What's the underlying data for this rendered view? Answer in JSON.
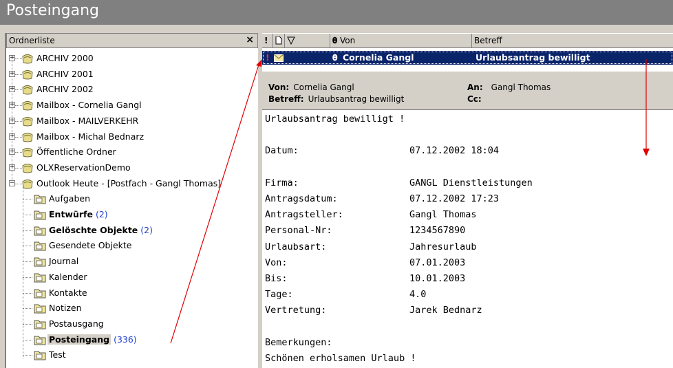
{
  "window": {
    "title": "Posteingang"
  },
  "folder_pane": {
    "header_label": "Ordnerliste",
    "close_glyph": "×",
    "items": [
      {
        "label": "ARCHIV 2000",
        "count": "",
        "level": 0,
        "expander": "+",
        "icon": "pst-folder-icon",
        "bold": false
      },
      {
        "label": "ARCHIV 2001",
        "count": "",
        "level": 0,
        "expander": "+",
        "icon": "pst-folder-icon",
        "bold": false
      },
      {
        "label": "ARCHIV 2002",
        "count": "",
        "level": 0,
        "expander": "+",
        "icon": "pst-folder-icon",
        "bold": false
      },
      {
        "label": "Mailbox - Cornelia Gangl",
        "count": "",
        "level": 0,
        "expander": "+",
        "icon": "mailbox-icon",
        "bold": false
      },
      {
        "label": "Mailbox - MAILVERKEHR",
        "count": "",
        "level": 0,
        "expander": "+",
        "icon": "mailbox-icon",
        "bold": false
      },
      {
        "label": "Mailbox - Michal Bednarz",
        "count": "",
        "level": 0,
        "expander": "+",
        "icon": "mailbox-icon",
        "bold": false
      },
      {
        "label": "Öffentliche Ordner",
        "count": "",
        "level": 0,
        "expander": "+",
        "icon": "public-folders-icon",
        "bold": false
      },
      {
        "label": "OLXReservationDemo",
        "count": "",
        "level": 0,
        "expander": "+",
        "icon": "pst-folder-icon",
        "bold": false
      },
      {
        "label": "Outlook Heute - [Postfach - Gangl Thomas]",
        "count": "",
        "level": 0,
        "expander": "−",
        "icon": "outlook-today-icon",
        "bold": false
      },
      {
        "label": "Aufgaben",
        "count": "",
        "level": 1,
        "expander": "",
        "icon": "tasks-icon",
        "bold": false
      },
      {
        "label": "Entwürfe",
        "count": "(2)",
        "level": 1,
        "expander": "",
        "icon": "drafts-icon",
        "bold": true
      },
      {
        "label": "Gelöschte Objekte",
        "count": "(2)",
        "level": 1,
        "expander": "",
        "icon": "deleted-items-icon",
        "bold": true
      },
      {
        "label": "Gesendete Objekte",
        "count": "",
        "level": 1,
        "expander": "",
        "icon": "sent-items-icon",
        "bold": false
      },
      {
        "label": "Journal",
        "count": "",
        "level": 1,
        "expander": "",
        "icon": "journal-icon",
        "bold": false
      },
      {
        "label": "Kalender",
        "count": "",
        "level": 1,
        "expander": "",
        "icon": "calendar-icon",
        "bold": false
      },
      {
        "label": "Kontakte",
        "count": "",
        "level": 1,
        "expander": "",
        "icon": "contacts-icon",
        "bold": false
      },
      {
        "label": "Notizen",
        "count": "",
        "level": 1,
        "expander": "",
        "icon": "notes-icon",
        "bold": false
      },
      {
        "label": "Postausgang",
        "count": "",
        "level": 1,
        "expander": "",
        "icon": "outbox-icon",
        "bold": false
      },
      {
        "label": "Posteingang",
        "count": "(336)",
        "level": 1,
        "expander": "",
        "icon": "inbox-icon",
        "bold": true,
        "selected": true
      },
      {
        "label": "Test",
        "count": "",
        "level": 1,
        "expander": "",
        "icon": "folder-icon",
        "bold": false
      }
    ]
  },
  "message_list": {
    "columns": [
      {
        "label": "!",
        "icon": "importance-icon"
      },
      {
        "label": "",
        "icon": "item-type-icon"
      },
      {
        "label": "",
        "icon": "flag-icon"
      },
      {
        "label": "Von",
        "icon": "attachment-icon"
      },
      {
        "label": "Betreff",
        "icon": ""
      }
    ],
    "rows": [
      {
        "importance": "!",
        "from": "Cornelia Gangl",
        "subject": "Urlaubsantrag bewilligt",
        "has_attachment": true,
        "selected": true
      }
    ]
  },
  "preview": {
    "from_label": "Von:",
    "from_value": "Cornelia Gangl",
    "to_label": "An:",
    "to_value": "Gangl Thomas",
    "subject_label": "Betreff:",
    "subject_value": "Urlaubsantrag bewilligt",
    "cc_label": "Cc:",
    "cc_value": "",
    "body": [
      {
        "key": "Urlaubsantrag bewilligt !",
        "value": ""
      },
      {
        "key": "",
        "value": ""
      },
      {
        "key": "Datum:",
        "value": "07.12.2002 18:04"
      },
      {
        "key": "",
        "value": ""
      },
      {
        "key": "Firma:",
        "value": "GANGL Dienstleistungen"
      },
      {
        "key": "Antragsdatum:",
        "value": "07.12.2002 17:23"
      },
      {
        "key": "Antragsteller:",
        "value": "Gangl Thomas"
      },
      {
        "key": "Personal-Nr:",
        "value": "1234567890"
      },
      {
        "key": "Urlaubsart:",
        "value": "Jahresurlaub"
      },
      {
        "key": "Von:",
        "value": "07.01.2003"
      },
      {
        "key": "Bis:",
        "value": "10.01.2003"
      },
      {
        "key": "Tage:",
        "value": "4.0"
      },
      {
        "key": "Vertretung:",
        "value": "Jarek Bednarz"
      },
      {
        "key": "",
        "value": ""
      },
      {
        "key": "Bemerkungen:",
        "value": ""
      },
      {
        "key": "Schönen erholsamen Urlaub !",
        "value": ""
      }
    ]
  },
  "colors": {
    "selection": "#0a246a",
    "annotation_arrow": "#e00000",
    "count_blue": "#1f3fd0"
  }
}
